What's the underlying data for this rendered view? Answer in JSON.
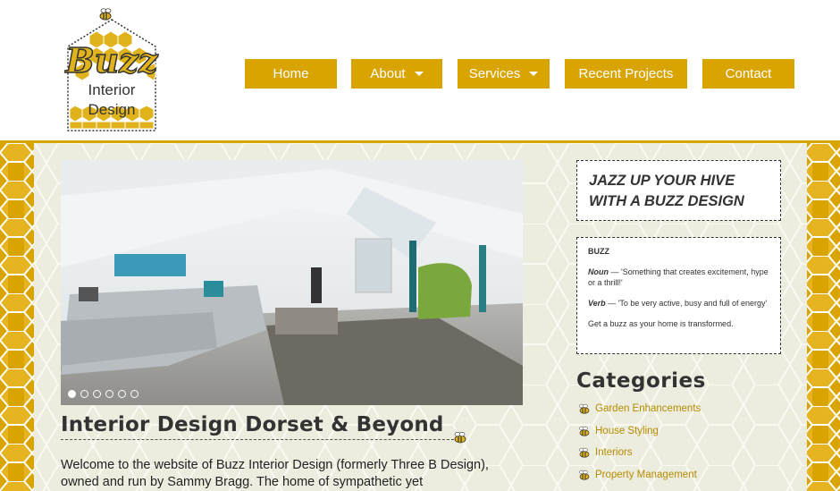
{
  "logo": {
    "line1": "Buzz",
    "line2": "Interior",
    "line3": "Design"
  },
  "nav": [
    {
      "label": "Home",
      "dropdown": false
    },
    {
      "label": "About",
      "dropdown": true
    },
    {
      "label": "Services",
      "dropdown": true
    },
    {
      "label": "Recent Projects",
      "dropdown": false
    },
    {
      "label": "Contact",
      "dropdown": false
    }
  ],
  "slider": {
    "slide_count": 6,
    "active_index": 0
  },
  "main": {
    "title": "Interior Design Dorset & Beyond",
    "intro": "Welcome to the website of Buzz Interior Design (formerly Three B Design), owned and run by Sammy Bragg. The home of sympathetic yet"
  },
  "sidebar": {
    "tagline": "JAZZ UP YOUR HIVE WITH A BUZZ DESIGN",
    "definition": {
      "word": "BUZZ",
      "noun_label": "Noun",
      "noun_text": " — 'Something that creates excitement, hype or a thrill!'",
      "verb_label": "Verb",
      "verb_text": " — 'To be very active, busy and full of energy'",
      "closing": "Get a buzz as your home is transformed."
    },
    "categories_heading": "Categories",
    "categories": [
      "Garden Enhancements",
      "House Styling",
      "Interiors",
      "Property Management"
    ]
  },
  "colors": {
    "brand_gold": "#d9a400",
    "background": "#ececdf",
    "link": "#b58c00"
  }
}
